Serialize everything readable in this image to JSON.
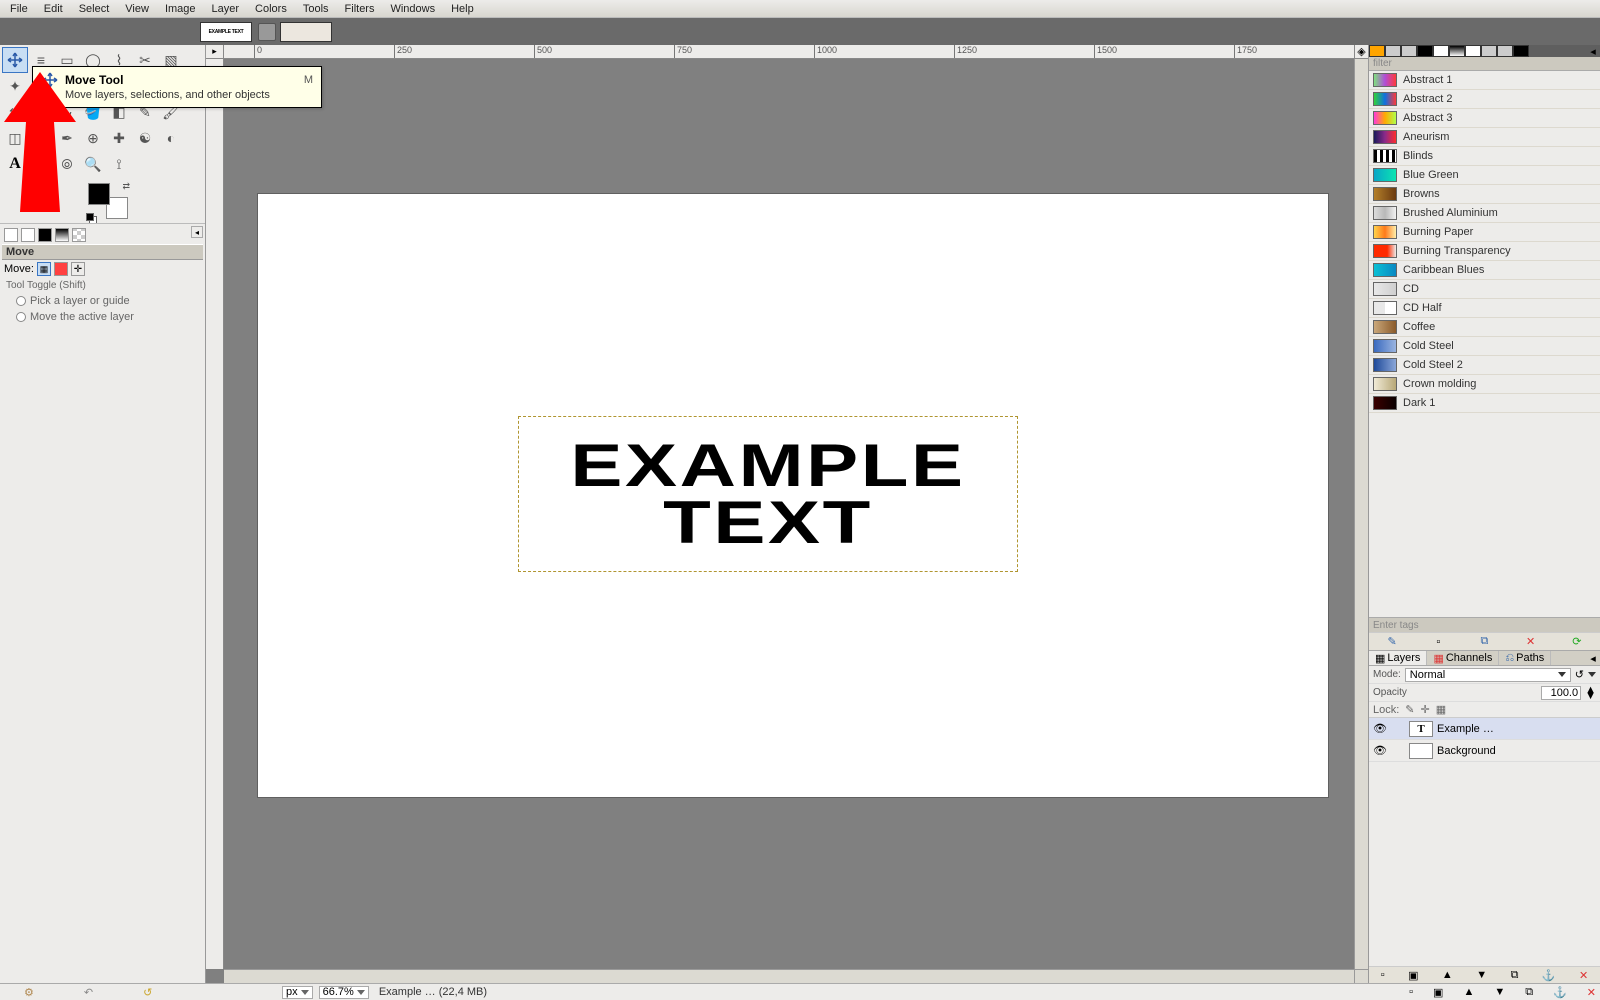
{
  "menu": [
    "File",
    "Edit",
    "Select",
    "View",
    "Image",
    "Layer",
    "Colors",
    "Tools",
    "Filters",
    "Windows",
    "Help"
  ],
  "tooltip": {
    "title": "Move Tool",
    "key": "M",
    "desc": "Move layers, selections, and other objects"
  },
  "toolopts": {
    "title": "Move",
    "rowlabel": "Move:",
    "toggle": "Tool Toggle  (Shift)",
    "radio1": "Pick a layer or guide",
    "radio2": "Move the active layer"
  },
  "rulers": [
    "0",
    "250",
    "500",
    "750",
    "1000",
    "1250",
    "1500",
    "1750"
  ],
  "canvas_text": "EXAMPLE\nTEXT",
  "status": {
    "unit": "px",
    "zoom": "66.7%",
    "docinfo": "Example … (22,4 MB)"
  },
  "filter_placeholder": "filter",
  "tags_placeholder": "Enter tags",
  "gradients": [
    {
      "name": "Abstract 1",
      "cls": "g-ab1"
    },
    {
      "name": "Abstract 2",
      "cls": "g-ab2"
    },
    {
      "name": "Abstract 3",
      "cls": "g-ab3"
    },
    {
      "name": "Aneurism",
      "cls": "g-ane"
    },
    {
      "name": "Blinds",
      "cls": "g-bli"
    },
    {
      "name": "Blue Green",
      "cls": "g-bgr"
    },
    {
      "name": "Browns",
      "cls": "g-bro"
    },
    {
      "name": "Brushed Aluminium",
      "cls": "g-bal"
    },
    {
      "name": "Burning Paper",
      "cls": "g-bpa"
    },
    {
      "name": "Burning Transparency",
      "cls": "g-btr"
    },
    {
      "name": "Caribbean Blues",
      "cls": "g-cbl"
    },
    {
      "name": "CD",
      "cls": "g-cd"
    },
    {
      "name": "CD Half",
      "cls": "g-cdh"
    },
    {
      "name": "Coffee",
      "cls": "g-cof"
    },
    {
      "name": "Cold Steel",
      "cls": "g-cst"
    },
    {
      "name": "Cold Steel 2",
      "cls": "g-cs2"
    },
    {
      "name": "Crown molding",
      "cls": "g-crm"
    },
    {
      "name": "Dark 1",
      "cls": "g-dk1"
    }
  ],
  "lcp": {
    "tabs": [
      "Layers",
      "Channels",
      "Paths"
    ],
    "mode_lbl": "Mode:",
    "mode": "Normal",
    "opacity_lbl": "Opacity",
    "opacity": "100.0",
    "lock": "Lock:"
  },
  "layers": [
    {
      "name": "Example …",
      "type": "text"
    },
    {
      "name": "Background",
      "type": "bg"
    }
  ]
}
